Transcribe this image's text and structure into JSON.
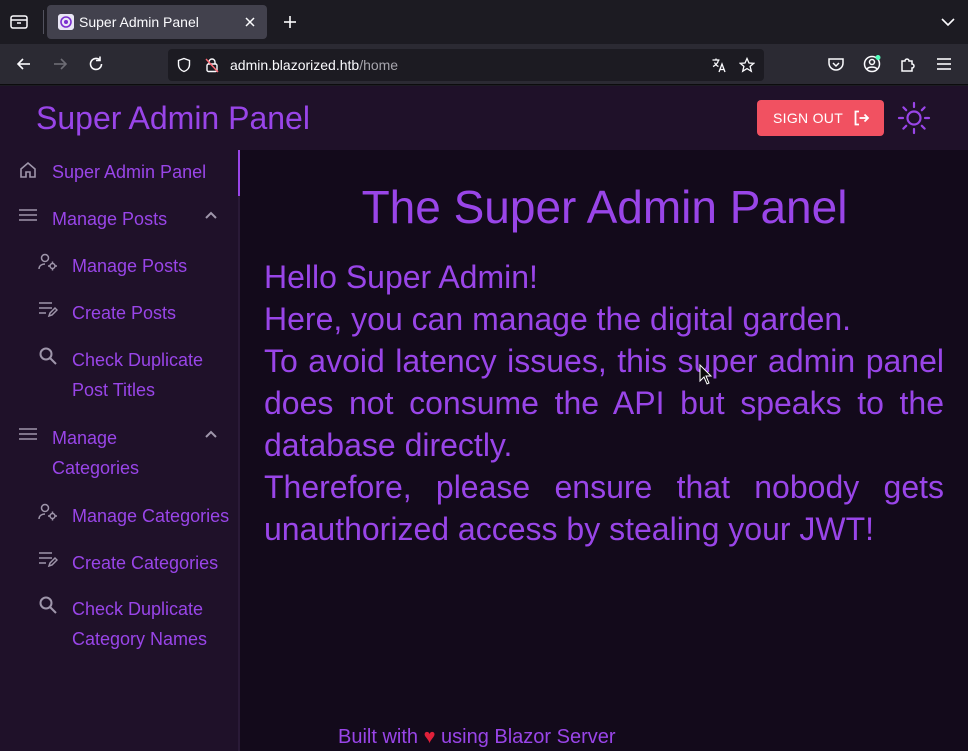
{
  "browser": {
    "tab_title": "Super Admin Panel",
    "url_host": "admin.blazorized.htb",
    "url_path": "/home"
  },
  "app": {
    "title": "Super Admin Panel",
    "sign_out_label": "SIGN OUT"
  },
  "sidebar": {
    "items": [
      {
        "label": "Super Admin Panel",
        "icon": "home-icon"
      },
      {
        "label": "Manage Posts",
        "icon": "menu-icon"
      },
      {
        "label": "Manage Posts",
        "icon": "user-settings-icon"
      },
      {
        "label": "Create Posts",
        "icon": "edit-list-icon"
      },
      {
        "label": "Check Duplicate Post Titles",
        "icon": "search-icon"
      },
      {
        "label": "Manage Categories",
        "icon": "menu-icon"
      },
      {
        "label": "Manage Categories",
        "icon": "user-settings-icon"
      },
      {
        "label": "Create Categories",
        "icon": "edit-list-icon"
      },
      {
        "label": "Check Duplicate Category Names",
        "icon": "search-icon"
      }
    ]
  },
  "main": {
    "heading": "The Super Admin Panel",
    "lines": [
      "Hello Super Admin!",
      "Here, you can manage the digital garden.",
      "To avoid latency issues, this super admin panel does not consume the API but speaks to the database directly.",
      "Therefore, please ensure that nobody gets unauthorized access by stealing your JWT!"
    ]
  },
  "footer": {
    "before": "Built with",
    "heart": "♥",
    "after": "using Blazor Server"
  },
  "colors": {
    "accent": "#9945e8",
    "sign_out": "#f15161",
    "background": "#130a1b",
    "panel": "#1f1129"
  }
}
